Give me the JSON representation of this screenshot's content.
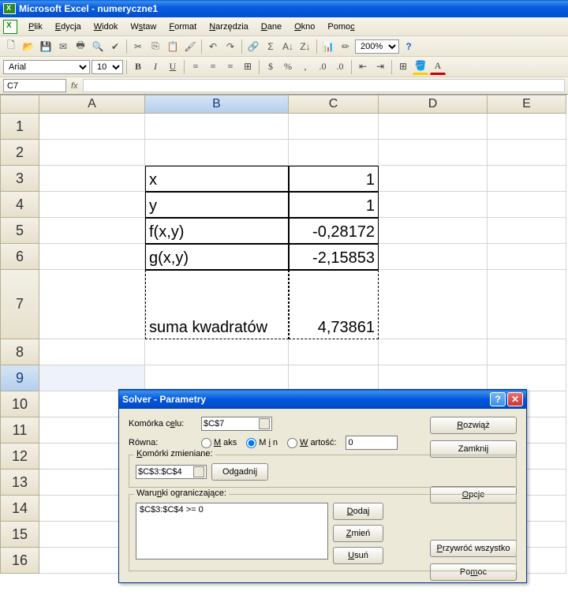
{
  "app_title": "Microsoft Excel - numeryczne1",
  "menu": {
    "file": "Plik",
    "edit": "Edycja",
    "view": "Widok",
    "insert": "Wstaw",
    "format": "Format",
    "tools": "Narzędzia",
    "data": "Dane",
    "window": "Okno",
    "help": "Pomoc"
  },
  "font": {
    "name": "Arial",
    "size": "10"
  },
  "zoom": "200%",
  "namebox": "C7",
  "fx_label": "fx",
  "cols": {
    "A": "A",
    "B": "B",
    "C": "C",
    "D": "D",
    "E": "E"
  },
  "rows": {
    "r1": "1",
    "r2": "2",
    "r3": "3",
    "r4": "4",
    "r5": "5",
    "r6": "6",
    "r7": "7",
    "r8": "8",
    "r9": "9",
    "r10": "10",
    "r11": "11",
    "r12": "12",
    "r13": "13",
    "r14": "14",
    "r15": "15",
    "r16": "16"
  },
  "cells": {
    "b3": "x",
    "c3": "1",
    "b4": "y",
    "c4": "1",
    "b5": "f(x,y)",
    "c5": "-0,28172",
    "b6": "g(x,y)",
    "c6": "-2,15853",
    "b7": "suma kwadratów",
    "c7": "4,73861"
  },
  "solver": {
    "title": "Solver - Parametry",
    "target_label": "Komórka celu:",
    "target_value": "$C$7",
    "equal_label": "Równa:",
    "opt_max": "Maks",
    "opt_min": "Min",
    "opt_value": "Wartość:",
    "value_input": "0",
    "changing_legend": "Komórki zmieniane:",
    "changing_value": "$C$3:$C$4",
    "guess_btn": "Odgadnij",
    "constraints_legend": "Warunki ograniczające:",
    "constraints_value": "$C$3:$C$4 >= 0",
    "add_btn": "Dodaj",
    "change_btn": "Zmień",
    "delete_btn": "Usuń",
    "solve_btn": "Rozwiąż",
    "close_btn": "Zamknij",
    "options_btn": "Opcje",
    "reset_btn": "Przywróć wszystko",
    "help_btn": "Pomoc"
  },
  "chart_data": {
    "type": "table",
    "categories": [
      "x",
      "y",
      "f(x,y)",
      "g(x,y)",
      "suma kwadratów"
    ],
    "values": [
      1,
      1,
      -0.28172,
      -2.15853,
      4.73861
    ]
  }
}
